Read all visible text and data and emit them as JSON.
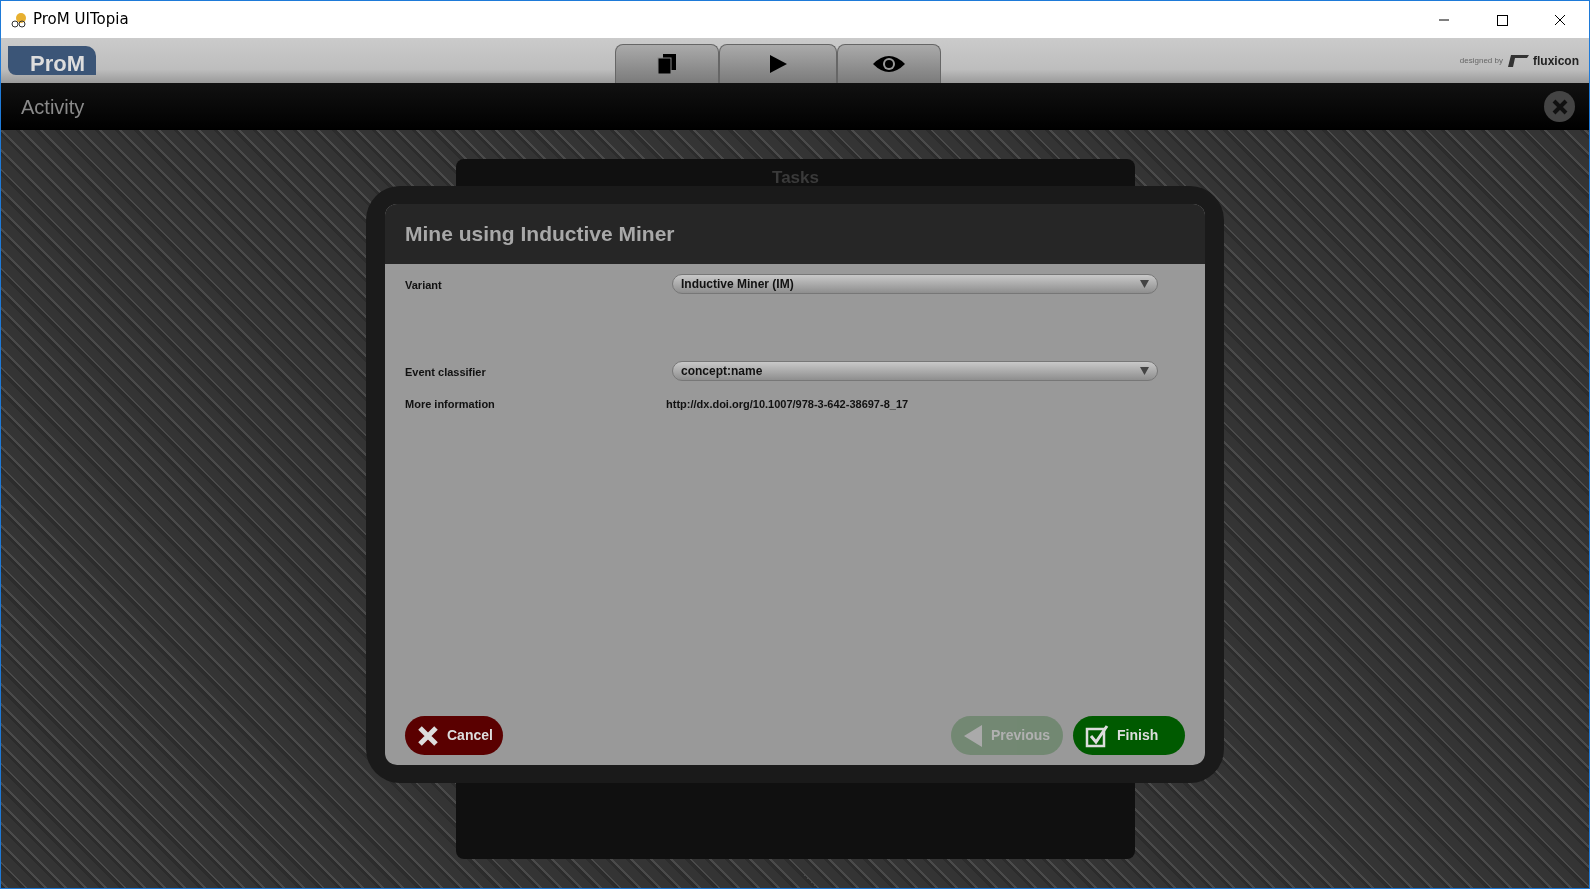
{
  "window": {
    "title": "ProM UITopia"
  },
  "app_logo": "ProM",
  "toolbar_tabs": [
    {
      "kind": "copy"
    },
    {
      "kind": "play"
    },
    {
      "kind": "view"
    }
  ],
  "designer": {
    "prefix": "designed by",
    "brand": "fluxicon"
  },
  "activity_bar": {
    "title": "Activity"
  },
  "background_panel": {
    "title": "Tasks"
  },
  "dialog": {
    "title": "Mine using Inductive Miner",
    "fields": [
      {
        "kind": "select",
        "label": "Variant",
        "value": "Inductive Miner (IM)"
      },
      {
        "kind": "select",
        "label": "Event classifier",
        "value": "concept:name"
      },
      {
        "kind": "link",
        "label": "More information",
        "value": "http://dx.doi.org/10.1007/978-3-642-38697-8_17"
      }
    ],
    "buttons": [
      {
        "kind": "cancel",
        "label": "Cancel",
        "disabled": false
      },
      {
        "kind": "previous",
        "label": "Previous",
        "disabled": true
      },
      {
        "kind": "finish",
        "label": "Finish",
        "disabled": false
      }
    ]
  }
}
